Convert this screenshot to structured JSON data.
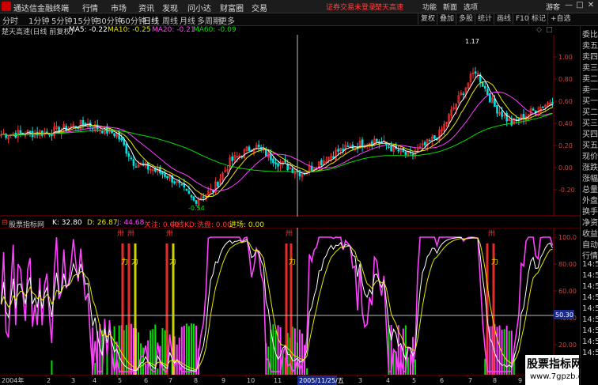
{
  "menubar": {
    "title": "通达信金融终端",
    "items": [
      "行情",
      "市场",
      "资讯",
      "发现",
      "问小达",
      "财富圈",
      "交易"
    ],
    "notice": "证券交易未登录",
    "stock_tag": "楚天高速",
    "tools": [
      "功能",
      "新面",
      "选项",
      "游客"
    ],
    "window": [
      "—",
      "□",
      "✕"
    ]
  },
  "periodbar": {
    "periods": [
      "分时",
      "1分钟",
      "5分钟",
      "15分钟",
      "30分钟",
      "60分钟",
      "日线",
      "周线",
      "月线",
      "多周期",
      "更多"
    ],
    "active": "日线",
    "right_buttons": [
      "复权",
      "叠加",
      "多股",
      "统计",
      "画线",
      "F10",
      "标记",
      "+自选"
    ]
  },
  "main_info": {
    "stock": "楚天高速(日线 前复权)",
    "ma5": "MA5: -0.22",
    "ma10": "MA10: -0.25",
    "ma20": "MA20: -0.21",
    "ma60": "MA60: -0.09"
  },
  "main_axis": {
    "ticks": [
      "1.00",
      "0.80",
      "0.60",
      "0.40",
      "0.20",
      "0.00",
      "-0.20"
    ],
    "high_label": "1.17",
    "low_label": "-0.54"
  },
  "indicator_info": {
    "name": "股票指标网",
    "k": "K: 32.80",
    "d": "D: 26.87",
    "j": "J: 44.68",
    "guanzhu": "关注: 0.00",
    "zhongxian": "中线KD:洗盘: 0.00",
    "jinchang": "进场: 0.00"
  },
  "ind_axis": {
    "ticks": [
      "100.0",
      "80.00",
      "60.00",
      "40.00",
      "20.00"
    ],
    "cursor_value": "50.30"
  },
  "markers": {
    "up": "卅",
    "power": "力"
  },
  "date_axis": {
    "start": "2004年",
    "labels": [
      "2",
      "3",
      "4",
      "5",
      "6",
      "7",
      "8",
      "9",
      "10",
      "11",
      "2",
      "3",
      "4",
      "5",
      "6",
      "7",
      "8",
      "9",
      "10"
    ],
    "cursor_date": "2005/11/25/五"
  },
  "right_panel": {
    "items": [
      "委比",
      "卖五",
      "卖四",
      "卖三",
      "卖二",
      "卖一",
      "买一",
      "买二",
      "买三",
      "买四",
      "买五",
      "现价",
      "涨跌",
      "涨幅",
      "总量",
      "外盘",
      "换手",
      "净资",
      "收益",
      "自动",
      "行情",
      "14:50",
      "14:50",
      "14:50",
      "14:50",
      "14:50",
      "14:50",
      "14:50",
      "14:50",
      "14:50"
    ]
  },
  "watermark": {
    "line1": "股票指标网",
    "line2": "www.7gpzb.com"
  },
  "colors": {
    "ma5": "#ffffff",
    "ma10": "#e8e800",
    "ma20": "#ff40ff",
    "ma60": "#00e000",
    "up": "#ff3030",
    "down": "#00e0e0",
    "axis": "#d04040"
  }
}
